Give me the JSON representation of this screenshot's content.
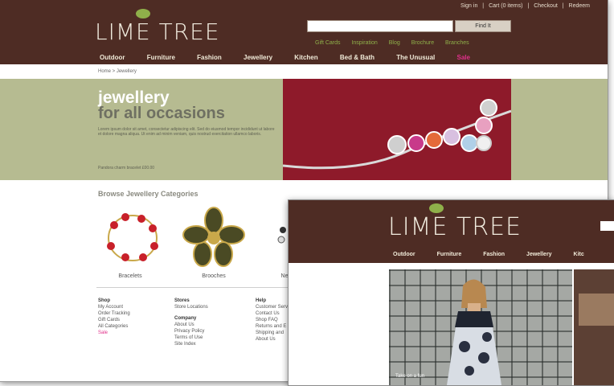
{
  "window1": {
    "top_links": [
      "Sign in",
      "|",
      "Cart (0 items)",
      "|",
      "Checkout",
      "|",
      "Redeem"
    ],
    "logo_text": "LIME TREE",
    "find_button": "Find It",
    "sub_nav": [
      "Gift Cards",
      "Inspiration",
      "Blog",
      "Brochure",
      "Branches"
    ],
    "main_nav": [
      "Outdoor",
      "Furniture",
      "Fashion",
      "Jewellery",
      "Kitchen",
      "Bed & Bath",
      "The Unusual",
      "Sale"
    ],
    "breadcrumb": "Home > Jewellery",
    "banner": {
      "title1": "jewellery",
      "title2": "for all occasions",
      "body": "Lorem ipsum dolor sit amet, consectetur adipiscing elit. Sed do eiusmod tempor incididunt ut labore et dolore magna aliqua. Ut enim ad minim veniam, quis nostrud exercitation ullamco laboris.",
      "price_line": "Pandora charm bracelet £00.00"
    },
    "browse_heading": "Browse Jewellery Categories",
    "categories": [
      "Bracelets",
      "Brooches",
      "Ne"
    ],
    "footer": {
      "shop": {
        "heading": "Shop",
        "items": [
          "My Account",
          "Order Tracking",
          "Gift Cards",
          "All Categories"
        ],
        "highlight": "Sale"
      },
      "stores": {
        "heading": "Stores",
        "items": [
          "Store Locations"
        ],
        "heading2": "Company",
        "items2": [
          "About Us",
          "Privacy Policy",
          "Terms of Use",
          "Site Index"
        ]
      },
      "help": {
        "heading": "Help",
        "items": [
          "Customer Serv",
          "Contact Us",
          "Shop FAQ",
          "Returns and E",
          "Shipping and",
          "About Us"
        ]
      }
    }
  },
  "window2": {
    "logo_text": "LIME TREE",
    "main_nav": [
      "Outdoor",
      "Furniture",
      "Fashion",
      "Jewellery",
      "Kitc"
    ],
    "photo_caption": "Take on a fun"
  },
  "colors": {
    "header": "#4e2c24",
    "banner": "#b6bb91",
    "accent_green": "#8fb04a",
    "accent_pink": "#e0308a",
    "banner_red": "#8e1a2a"
  }
}
